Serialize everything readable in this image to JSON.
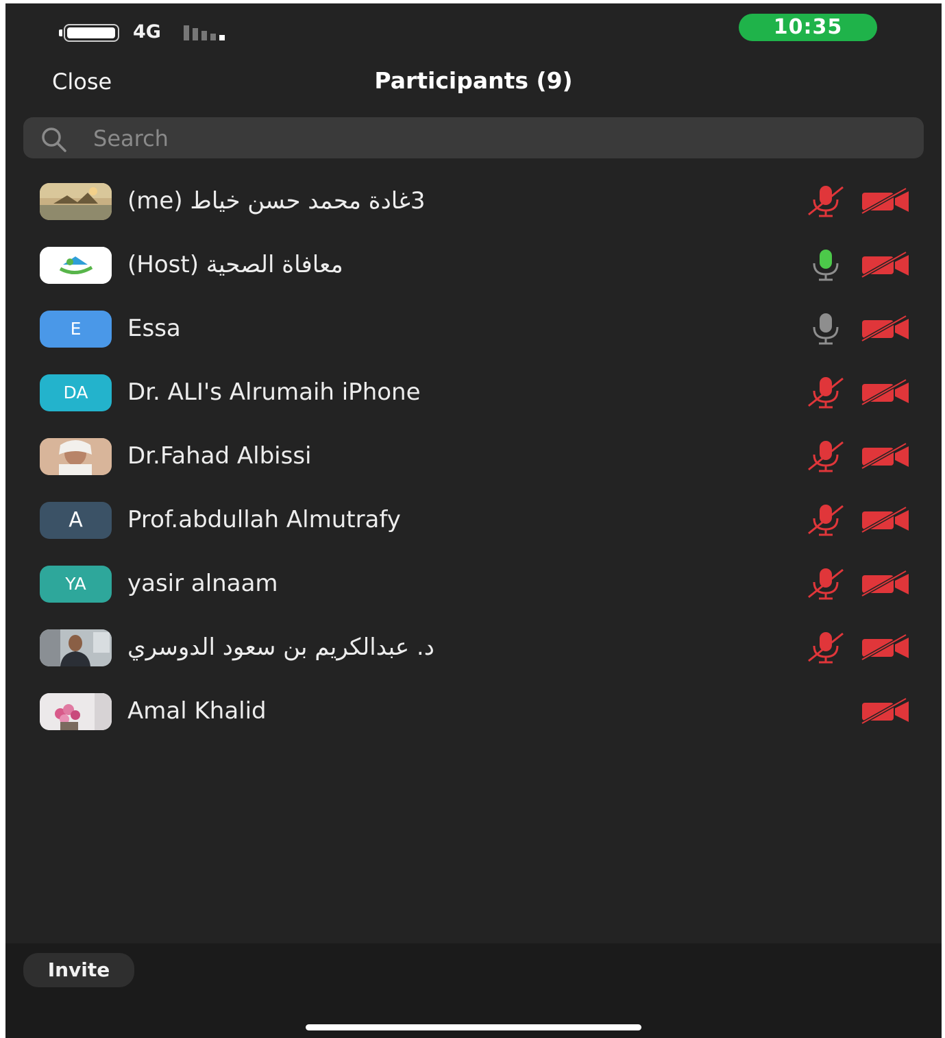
{
  "status_bar": {
    "network": "4G",
    "time": "10:35",
    "time_pill_color": "#1fb34a"
  },
  "header": {
    "close_label": "Close",
    "title": "Participants (9)"
  },
  "search": {
    "placeholder": "Search"
  },
  "participants": [
    {
      "name": "3غادة محمد حسن خياط (me)",
      "avatar": "photo-landscape",
      "mic": "muted",
      "camera": "off"
    },
    {
      "name": "معافاة الصحية (Host)",
      "avatar": "photo-logo",
      "mic": "active",
      "camera": "off"
    },
    {
      "name": "Essa",
      "avatar_initials": "E",
      "avatar_color": "#4a98e8",
      "mic": "unmuted-idle",
      "camera": "off"
    },
    {
      "name": "Dr. ALI's Alrumaih iPhone",
      "avatar_initials": "DA",
      "avatar_color": "#23b3cc",
      "mic": "muted",
      "camera": "off"
    },
    {
      "name": "Dr.Fahad Albissi",
      "avatar": "photo-portrait",
      "mic": "muted",
      "camera": "off"
    },
    {
      "name": "Prof.abdullah Almutrafy",
      "avatar_initials": "A",
      "avatar_color": "#3b5266",
      "mic": "muted",
      "camera": "off"
    },
    {
      "name": "yasir alnaam",
      "avatar_initials": "YA",
      "avatar_color": "#2ea79b",
      "mic": "muted",
      "camera": "off"
    },
    {
      "name": "د. عبدالكريم بن سعود الدوسري",
      "avatar": "photo-person",
      "mic": "muted",
      "camera": "off"
    },
    {
      "name": "Amal Khalid",
      "avatar": "photo-flowers",
      "mic": "none",
      "camera": "off"
    }
  ],
  "colors": {
    "muted_red": "#e0363a",
    "active_green": "#4cc94a",
    "idle_gray": "#8e8e8e"
  },
  "footer": {
    "invite_label": "Invite"
  }
}
